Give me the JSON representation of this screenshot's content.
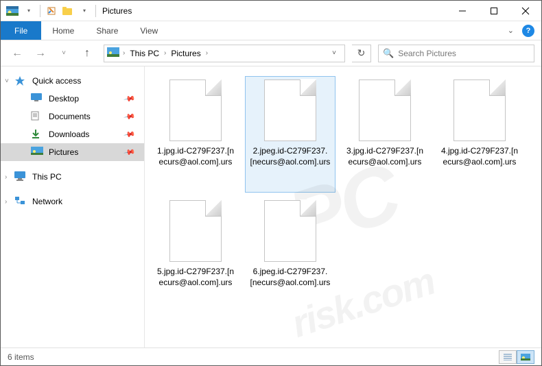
{
  "title": "Pictures",
  "ribbon": {
    "file": "File",
    "tabs": [
      "Home",
      "Share",
      "View"
    ]
  },
  "nav": {
    "breadcrumb": [
      "This PC",
      "Pictures"
    ],
    "search_placeholder": "Search Pictures"
  },
  "sidebar": {
    "quick": "Quick access",
    "items": [
      {
        "label": "Desktop",
        "pinned": true
      },
      {
        "label": "Documents",
        "pinned": true
      },
      {
        "label": "Downloads",
        "pinned": true
      },
      {
        "label": "Pictures",
        "pinned": true,
        "selected": true
      }
    ],
    "thispc": "This PC",
    "network": "Network"
  },
  "files": {
    "items": [
      {
        "name": "1.jpg.id-C279F237.[necurs@aol.com].urs",
        "selected": false
      },
      {
        "name": "2.jpeg.id-C279F237.[necurs@aol.com].urs",
        "selected": true
      },
      {
        "name": "3.jpg.id-C279F237.[necurs@aol.com].urs",
        "selected": false
      },
      {
        "name": "4.jpg.id-C279F237.[necurs@aol.com].urs",
        "selected": false
      },
      {
        "name": "5.jpg.id-C279F237.[necurs@aol.com].urs",
        "selected": false
      },
      {
        "name": "6.jpeg.id-C279F237.[necurs@aol.com].urs",
        "selected": false
      }
    ]
  },
  "status": {
    "count": "6 items"
  },
  "watermark": {
    "big": "PC",
    "small": "risk.com"
  }
}
